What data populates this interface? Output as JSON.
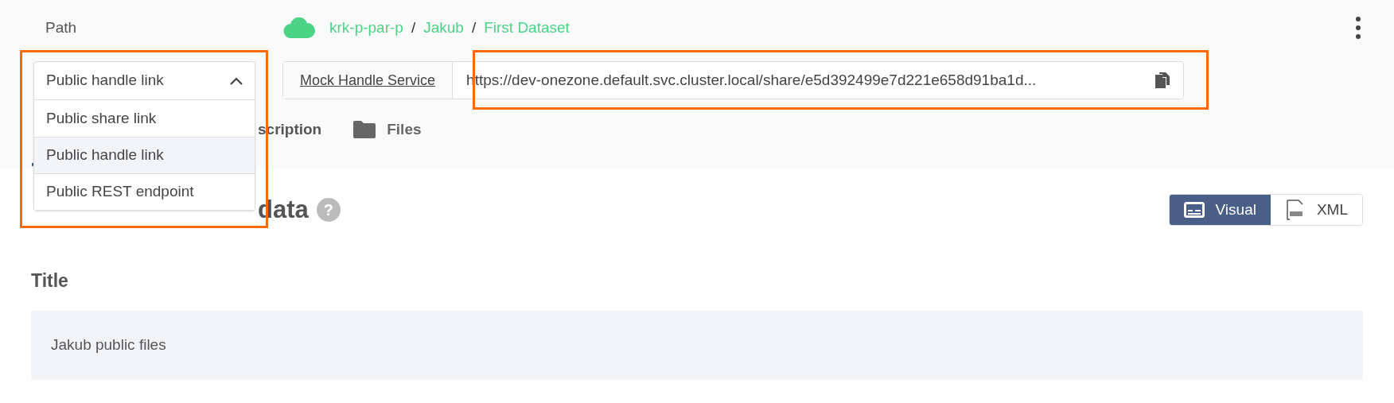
{
  "path": {
    "label": "Path",
    "breadcrumbs": [
      "krk-p-par-p",
      "Jakub",
      "First Dataset"
    ],
    "separator": "/"
  },
  "link_selector": {
    "value": "Public handle link",
    "expanded": true,
    "options": [
      {
        "label": "Public share link",
        "selected": false
      },
      {
        "label": "Public handle link",
        "selected": true
      },
      {
        "label": "Public REST endpoint",
        "selected": false
      }
    ]
  },
  "handle_service": "Mock Handle Service",
  "url": "https://dev-onezone.default.svc.cluster.local/share/e5d392499e7d221e658d91ba1d...",
  "tabs": [
    {
      "label": "scription",
      "selected": true
    },
    {
      "label": "Files",
      "selected": false
    }
  ],
  "metadata": {
    "heading": "data",
    "help": "?",
    "modes": [
      {
        "label": "Visual",
        "selected": true
      },
      {
        "label": "XML",
        "selected": false
      }
    ],
    "fields": [
      {
        "label": "Title",
        "value": "Jakub public files"
      }
    ]
  }
}
